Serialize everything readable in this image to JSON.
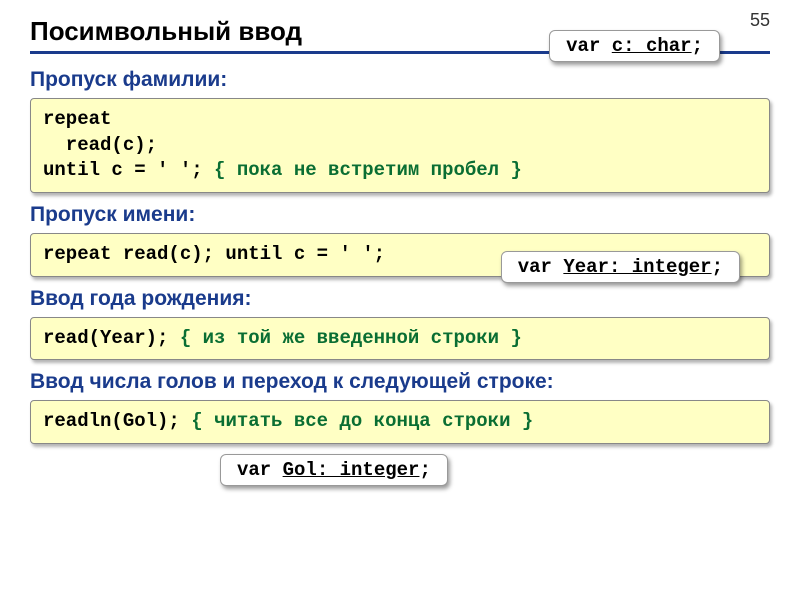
{
  "page_number": "55",
  "title": "Посимвольный ввод",
  "sections": {
    "s1": {
      "heading": "Пропуск фамилии:",
      "code": "repeat\n  read(c);\nuntil c = ' '; ",
      "comment": "{ пока не встретим пробел }",
      "var_prefix": "var ",
      "var_decl": "c: char",
      "var_suffix": ";"
    },
    "s2": {
      "heading": "Пропуск имени:",
      "code": "repeat read(c); until c = ' ';"
    },
    "s3": {
      "heading": "Ввод года рождения:",
      "code": "read(Year); ",
      "comment": "{ из той же введенной строки }",
      "var_prefix": "var ",
      "var_decl": "Year: integer",
      "var_suffix": ";"
    },
    "s4": {
      "heading": "Ввод числа голов и переход к следующей строке:",
      "code": "readln(Gol); ",
      "comment": "{ читать все до конца строки }",
      "var_prefix": "var ",
      "var_decl": "Gol: integer",
      "var_suffix": ";"
    }
  }
}
